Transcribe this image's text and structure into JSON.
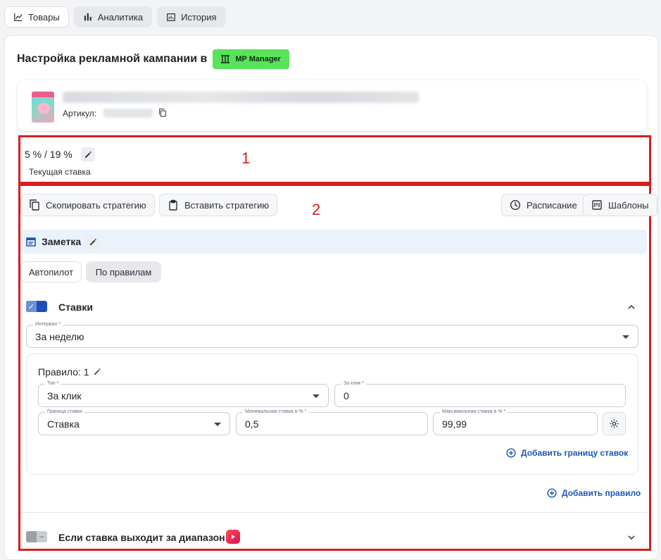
{
  "nav": {
    "tabs": [
      {
        "label": "Товары",
        "icon": "chart-line-icon"
      },
      {
        "label": "Аналитика",
        "icon": "bar-chart-icon"
      },
      {
        "label": "История",
        "icon": "history-chart-icon"
      }
    ]
  },
  "header": {
    "title": "Настройка рекламной кампании в",
    "badge": "MP Manager"
  },
  "product": {
    "article_label": "Артикул:"
  },
  "bid": {
    "value": "5 % / 19 %",
    "label": "Текущая ставка"
  },
  "annotations": {
    "box1": "1",
    "box2": "2"
  },
  "toolbar": {
    "copy_label": "Скопировать стратегию",
    "paste_label": "Вставить стратегию",
    "schedule_label": "Расписание",
    "templates_label": "Шаблоны"
  },
  "note": {
    "label": "Заметка"
  },
  "modes": {
    "autopilot": "Автопилот",
    "rules": "По правилам"
  },
  "bids_section": {
    "title": "Ставки",
    "interval_label": "Интервал *",
    "interval_value": "За неделю",
    "rule": {
      "title": "Правило: 1",
      "type_label": "Тип *",
      "type_value": "За клик",
      "per_click_label": "За клик *",
      "per_click_value": "0",
      "bound_label": "Граница ставки",
      "bound_value": "Ставка",
      "min_label": "Минимальная ставка в % *",
      "min_value": "0,5",
      "max_label": "Максимальная ставка в % *",
      "max_value": "99,99",
      "add_bound": "Добавить границу ставок"
    },
    "add_rule": "Добавить правило"
  },
  "out_of_range": {
    "title": "Если ставка выходит за диапазон"
  },
  "colors": {
    "accent": "#1d56b6",
    "annotation": "#d91d1d",
    "badge": "#57e35a"
  }
}
